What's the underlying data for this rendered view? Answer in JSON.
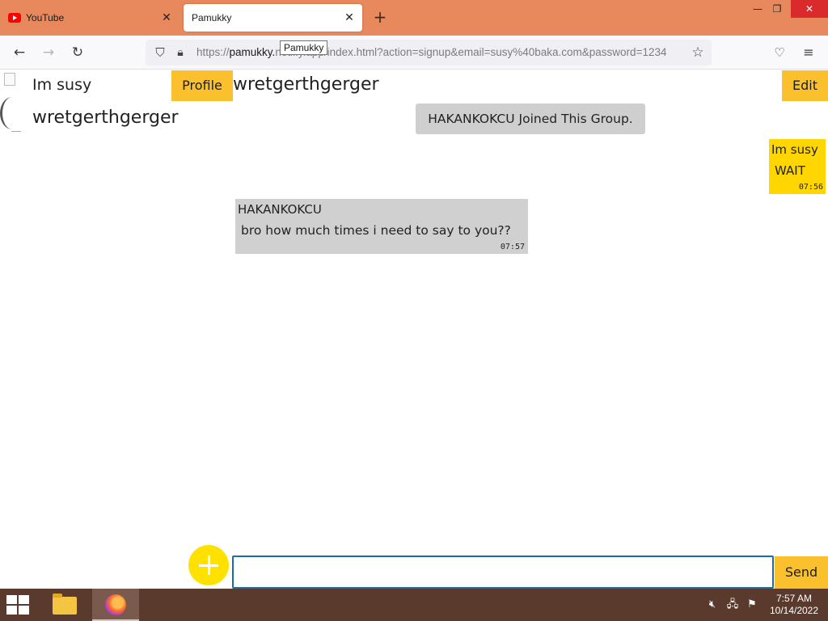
{
  "browser": {
    "tabs": [
      {
        "label": "YouTube",
        "icon": "youtube-icon"
      },
      {
        "label": "Pamukky",
        "active": true
      }
    ],
    "url": {
      "prefix": "https://",
      "domain": "pamukky.",
      "rest": "netlify.app/index.html?action=signup&email=susy%40baka.com&password=1234"
    },
    "tooltip": "Pamukky"
  },
  "chat": {
    "user_name": "Im susy",
    "user_status": "wretgerthgerger",
    "profile_label": "Profile",
    "group_name": "wretgerthgerger",
    "edit_label": "Edit",
    "system_message": "HAKANKOKCU Joined This Group.",
    "messages": [
      {
        "sender": "Im susy",
        "text": "WAIT",
        "time": "07:56",
        "mine": true
      },
      {
        "sender": "HAKANKOKCU",
        "text": "bro how much times i need to say to you??",
        "time": "07:57",
        "mine": false
      }
    ],
    "input_placeholder": "",
    "send_label": "Send",
    "colors": {
      "accent": "#fbc02d",
      "my_bubble": "#ffd600",
      "other_bubble": "#d0d0d0"
    }
  },
  "taskbar": {
    "time": "7:57 AM",
    "date": "10/14/2022"
  }
}
